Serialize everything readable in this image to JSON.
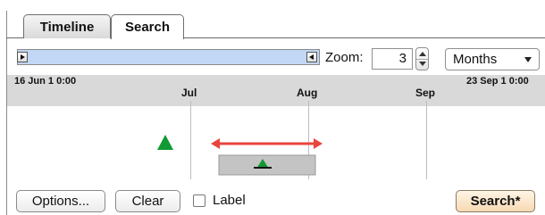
{
  "tabs": [
    {
      "label": "Timeline",
      "active": false
    },
    {
      "label": "Search",
      "active": true
    }
  ],
  "toolbar": {
    "zoom_label": "Zoom:",
    "zoom_value": "3",
    "unit_selected": "Months"
  },
  "timeline": {
    "start_label": "16 Jun 1 0:00",
    "end_label": "23 Sep 1 0:00",
    "months": [
      "Jul",
      "Aug",
      "Sep"
    ]
  },
  "footer": {
    "options_label": "Options...",
    "clear_label": "Clear",
    "label_checkbox_label": "Label",
    "label_checked": false,
    "search_label": "Search*"
  },
  "colors": {
    "accent_red": "#e8453c",
    "marker_green": "#119933",
    "scroll_track": "#c2d7f5",
    "search_button": "#f7d9b3"
  }
}
